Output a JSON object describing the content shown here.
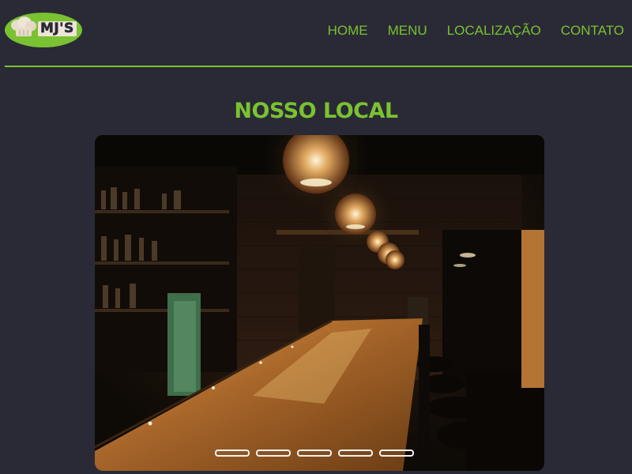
{
  "brand": {
    "logo_text": "MJ'S",
    "logo_color": "#7ac231"
  },
  "nav": {
    "items": [
      {
        "label": "HOME"
      },
      {
        "label": "MENU"
      },
      {
        "label": "LOCALIZAÇÃO"
      },
      {
        "label": "CONTATO"
      }
    ]
  },
  "section": {
    "title": "NOSSO LOCAL"
  },
  "carousel": {
    "image": "bar-interior-photo",
    "slide_count": 5,
    "active_slide": 1
  },
  "colors": {
    "background": "#2a2a36",
    "accent": "#7ac231",
    "indicator": "#f2f2f2"
  }
}
